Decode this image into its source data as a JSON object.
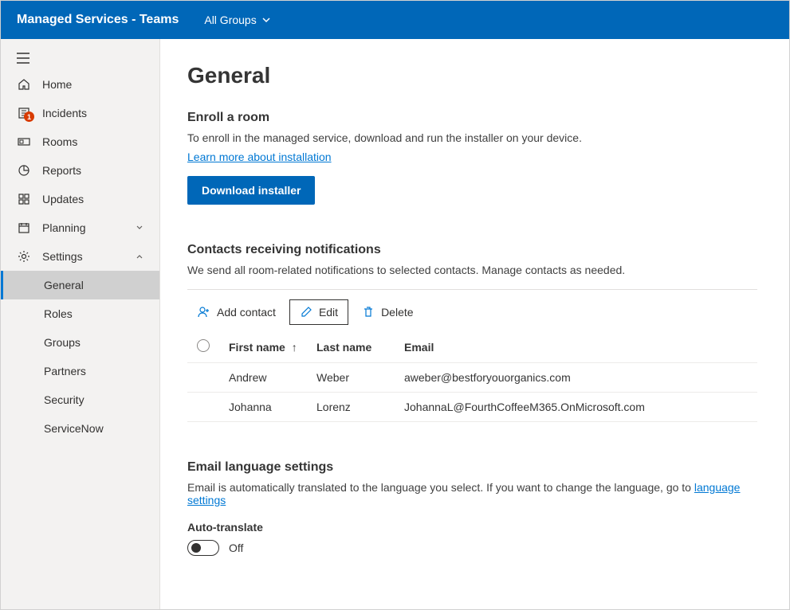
{
  "header": {
    "app_title": "Managed Services - Teams",
    "group_selector": "All Groups"
  },
  "sidebar": {
    "items": [
      {
        "label": "Home",
        "icon": "home-icon"
      },
      {
        "label": "Incidents",
        "icon": "incidents-icon",
        "badge": "1"
      },
      {
        "label": "Rooms",
        "icon": "rooms-icon"
      },
      {
        "label": "Reports",
        "icon": "reports-icon"
      },
      {
        "label": "Updates",
        "icon": "updates-icon"
      },
      {
        "label": "Planning",
        "icon": "planning-icon",
        "expandable": true,
        "expanded": false
      },
      {
        "label": "Settings",
        "icon": "settings-icon",
        "expandable": true,
        "expanded": true
      }
    ],
    "settings_children": [
      {
        "label": "General",
        "active": true
      },
      {
        "label": "Roles"
      },
      {
        "label": "Groups"
      },
      {
        "label": "Partners"
      },
      {
        "label": "Security"
      },
      {
        "label": "ServiceNow"
      }
    ]
  },
  "page": {
    "title": "General",
    "enroll": {
      "heading": "Enroll a room",
      "description": "To enroll in the managed service, download and run the installer on your device.",
      "learn_more": "Learn more about installation",
      "download_button": "Download installer"
    },
    "contacts": {
      "heading": "Contacts receiving notifications",
      "description": "We send all room-related notifications to selected contacts. Manage contacts as needed.",
      "toolbar": {
        "add": "Add contact",
        "edit": "Edit",
        "delete": "Delete"
      },
      "columns": {
        "first_name": "First name",
        "last_name": "Last name",
        "email": "Email"
      },
      "rows": [
        {
          "first": "Andrew",
          "last": "Weber",
          "email": "aweber@bestforyouorganics.com"
        },
        {
          "first": "Johanna",
          "last": "Lorenz",
          "email": "JohannaL@FourthCoffeeM365.OnMicrosoft.com"
        }
      ]
    },
    "email_lang": {
      "heading": "Email language settings",
      "description_prefix": "Email is automatically translated to the language you select. If you want to change the language, go to ",
      "link": "language settings",
      "toggle_label": "Auto-translate",
      "toggle_state": "Off"
    }
  }
}
